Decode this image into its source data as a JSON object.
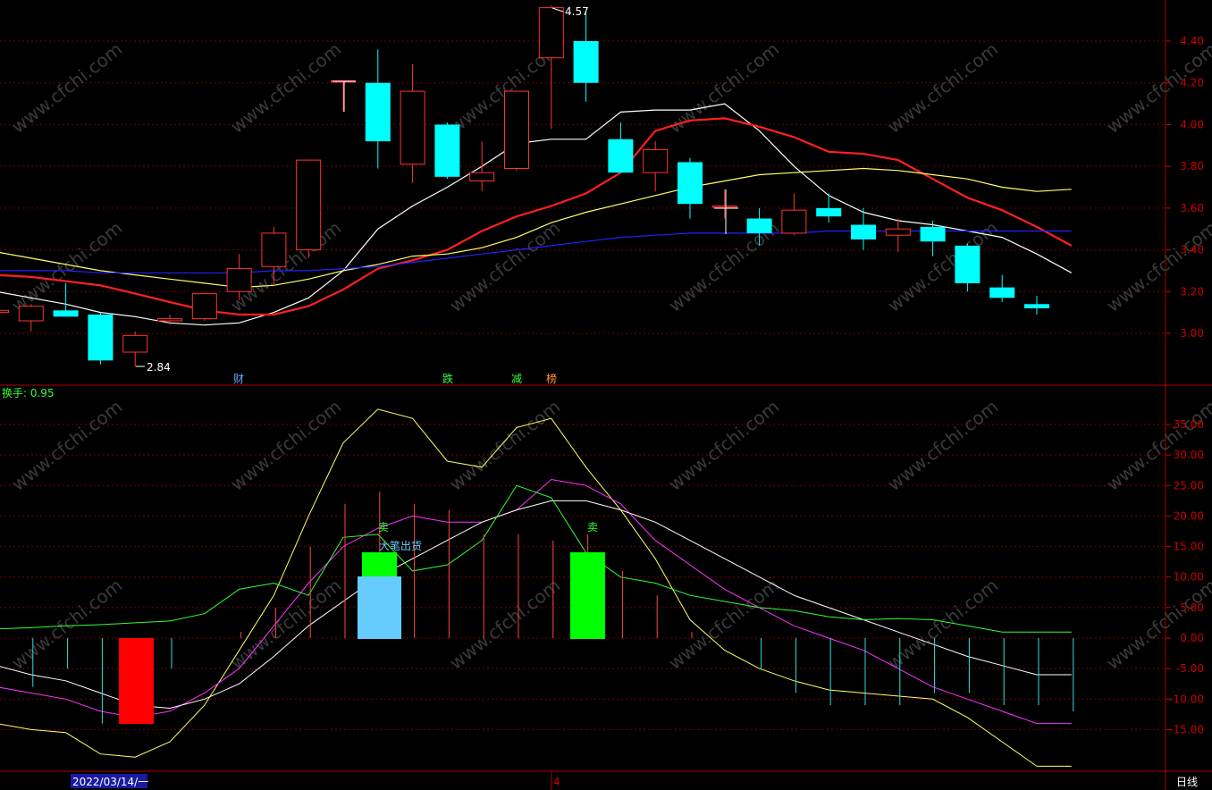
{
  "watermark": "www.cfchi.com",
  "price_panel": {
    "y_ticks": [
      "4.40",
      "4.20",
      "4.00",
      "3.80",
      "3.60",
      "3.40",
      "3.20",
      "3.00"
    ],
    "high_label": "4.57",
    "low_label": "2.84",
    "event_markers": [
      {
        "text": "财",
        "color": "#66aaff"
      },
      {
        "text": "跌",
        "color": "#33ff33"
      },
      {
        "text": "减",
        "color": "#33ff33"
      },
      {
        "text": "榜",
        "color": "#ff9933"
      }
    ]
  },
  "indicator_panel": {
    "turnover_label": "换手: 0.95",
    "y_ticks": [
      "35.00",
      "30.00",
      "25.00",
      "20.00",
      "15.00",
      "10.00",
      "5.00",
      "0.00",
      "-5.00",
      "-10.00",
      "-15.00"
    ],
    "signal_sell_1": "卖",
    "signal_big_sell": "大笔出货",
    "signal_sell_2": "卖"
  },
  "footer": {
    "date": "2022/03/14/一",
    "month_marker": "4",
    "period": "日线"
  },
  "colors": {
    "grid": "#7a0000",
    "axis_text": "#cc0000",
    "up": "#ff3333",
    "down": "#00ffff",
    "ma5": "#ffffff",
    "ma10": "#ff2020",
    "ma20": "#ffff66",
    "ma60": "#2222ff"
  },
  "chart_data": {
    "type": "candlestick",
    "y_range_price": [
      2.8,
      4.55
    ],
    "candles": [
      {
        "o": 3.1,
        "h": 3.12,
        "l": 3.09,
        "c": 3.11
      },
      {
        "o": 3.06,
        "h": 3.14,
        "l": 3.01,
        "c": 3.13
      },
      {
        "o": 3.11,
        "h": 3.24,
        "l": 3.09,
        "c": 3.08
      },
      {
        "o": 3.09,
        "h": 3.1,
        "l": 2.85,
        "c": 2.87
      },
      {
        "o": 2.91,
        "h": 3.01,
        "l": 2.84,
        "c": 2.99
      },
      {
        "o": 3.06,
        "h": 3.09,
        "l": 3.04,
        "c": 3.07
      },
      {
        "o": 3.07,
        "h": 3.19,
        "l": 3.06,
        "c": 3.19
      },
      {
        "o": 3.2,
        "h": 3.38,
        "l": 3.16,
        "c": 3.31
      },
      {
        "o": 3.32,
        "h": 3.51,
        "l": 3.23,
        "c": 3.48
      },
      {
        "o": 3.4,
        "h": 3.83,
        "l": 3.36,
        "c": 3.83
      },
      {
        "o": 4.21,
        "h": 4.21,
        "l": 4.06,
        "c": 4.21
      },
      {
        "o": 4.2,
        "h": 4.36,
        "l": 3.79,
        "c": 3.92
      },
      {
        "o": 3.81,
        "h": 4.29,
        "l": 3.72,
        "c": 4.16
      },
      {
        "o": 4.0,
        "h": 4.01,
        "l": 3.74,
        "c": 3.75
      },
      {
        "o": 3.73,
        "h": 3.92,
        "l": 3.68,
        "c": 3.77
      },
      {
        "o": 3.79,
        "h": 4.16,
        "l": 3.78,
        "c": 4.16
      },
      {
        "o": 4.32,
        "h": 4.57,
        "l": 3.98,
        "c": 4.56
      },
      {
        "o": 4.4,
        "h": 4.54,
        "l": 4.11,
        "c": 4.2
      },
      {
        "o": 3.93,
        "h": 4.01,
        "l": 3.77,
        "c": 3.77
      },
      {
        "o": 3.77,
        "h": 3.92,
        "l": 3.68,
        "c": 3.88
      },
      {
        "o": 3.82,
        "h": 3.84,
        "l": 3.55,
        "c": 3.62
      },
      {
        "o": 3.61,
        "h": 3.69,
        "l": 3.55,
        "c": 3.61
      },
      {
        "o": 3.55,
        "h": 3.6,
        "l": 3.42,
        "c": 3.48
      },
      {
        "o": 3.48,
        "h": 3.67,
        "l": 3.47,
        "c": 3.59
      },
      {
        "o": 3.6,
        "h": 3.67,
        "l": 3.53,
        "c": 3.56
      },
      {
        "o": 3.52,
        "h": 3.6,
        "l": 3.4,
        "c": 3.45
      },
      {
        "o": 3.47,
        "h": 3.55,
        "l": 3.39,
        "c": 3.5
      },
      {
        "o": 3.51,
        "h": 3.54,
        "l": 3.37,
        "c": 3.44
      },
      {
        "o": 3.42,
        "h": 3.43,
        "l": 3.2,
        "c": 3.24
      },
      {
        "o": 3.22,
        "h": 3.28,
        "l": 3.15,
        "c": 3.17
      },
      {
        "o": 3.14,
        "h": 3.18,
        "l": 3.09,
        "c": 3.12
      }
    ],
    "ma_lines": [
      {
        "key": "ma5",
        "values": [
          3.2,
          3.17,
          3.14,
          3.1,
          3.08,
          3.05,
          3.04,
          3.05,
          3.1,
          3.17,
          3.3,
          3.5,
          3.61,
          3.7,
          3.8,
          3.91,
          3.93,
          3.93,
          4.06,
          4.07,
          4.07,
          4.1,
          3.97,
          3.8,
          3.66,
          3.58,
          3.54,
          3.52,
          3.49,
          3.46,
          3.38,
          3.29
        ]
      },
      {
        "key": "ma10",
        "values": [
          3.28,
          3.27,
          3.25,
          3.23,
          3.19,
          3.15,
          3.11,
          3.09,
          3.09,
          3.13,
          3.21,
          3.31,
          3.35,
          3.4,
          3.49,
          3.56,
          3.61,
          3.67,
          3.77,
          3.97,
          4.02,
          4.03,
          3.99,
          3.94,
          3.87,
          3.86,
          3.83,
          3.74,
          3.65,
          3.59,
          3.51,
          3.42
        ]
      },
      {
        "key": "ma20",
        "values": [
          3.39,
          3.36,
          3.33,
          3.3,
          3.28,
          3.26,
          3.24,
          3.22,
          3.23,
          3.26,
          3.3,
          3.33,
          3.37,
          3.38,
          3.41,
          3.46,
          3.53,
          3.58,
          3.62,
          3.66,
          3.7,
          3.73,
          3.76,
          3.77,
          3.78,
          3.79,
          3.78,
          3.76,
          3.74,
          3.7,
          3.68,
          3.69
        ]
      },
      {
        "key": "ma60",
        "values": [
          3.3,
          3.3,
          3.3,
          3.29,
          3.29,
          3.29,
          3.29,
          3.29,
          3.3,
          3.3,
          3.31,
          3.32,
          3.34,
          3.36,
          3.38,
          3.4,
          3.42,
          3.44,
          3.46,
          3.47,
          3.48,
          3.48,
          3.48,
          3.48,
          3.49,
          3.49,
          3.49,
          3.49,
          3.49,
          3.49,
          3.49,
          3.49
        ]
      }
    ],
    "y_range_indicator": [
      -21,
      40
    ],
    "histogram": [
      -8,
      -8,
      -5,
      -14,
      -9,
      -5,
      0,
      1,
      5,
      15,
      22,
      24,
      22,
      21,
      17,
      17,
      16,
      17,
      11,
      7,
      1,
      0,
      -5,
      -9,
      -11,
      -11,
      -11,
      -9,
      -9,
      -11,
      -11,
      -12
    ],
    "indicator_lines": [
      {
        "key": "line_yellow",
        "color": "#ffff66",
        "values": [
          -14,
          -15,
          -15.5,
          -19,
          -19.5,
          -17,
          -11,
          -2,
          7,
          20,
          32,
          37.5,
          36,
          29,
          28,
          34.5,
          36,
          28,
          21,
          13,
          3,
          -2,
          -5,
          -7,
          -8.5,
          -9,
          -9.5,
          -10,
          -13,
          -17,
          -21,
          -21
        ]
      },
      {
        "key": "line_magenta",
        "color": "#ff33ff",
        "values": [
          -8,
          -9,
          -10,
          -12,
          -13,
          -12,
          -9,
          -5,
          2,
          9,
          15,
          18,
          20,
          19,
          19,
          21,
          26,
          25,
          22,
          16,
          12,
          8,
          5,
          2,
          0,
          -2,
          -5,
          -8,
          -10,
          -12,
          -14,
          -14
        ]
      },
      {
        "key": "line_white",
        "color": "#ffffff",
        "values": [
          -4.5,
          -6,
          -7,
          -9,
          -11,
          -11.5,
          -10,
          -7.5,
          -3,
          2,
          6,
          10,
          13,
          16,
          19,
          21,
          22.5,
          22.5,
          21,
          19,
          16,
          13,
          10,
          7,
          5,
          3,
          1,
          -1,
          -3,
          -4.5,
          -6,
          -6
        ]
      },
      {
        "key": "line_green",
        "color": "#33ff33",
        "values": [
          1.5,
          1.7,
          2,
          2.2,
          2.5,
          2.8,
          4,
          8,
          9,
          7,
          16.5,
          17,
          11,
          12,
          16,
          25,
          23,
          14,
          10,
          9,
          7,
          6,
          5,
          4.5,
          3.5,
          3,
          3.2,
          3,
          2,
          1,
          1,
          1
        ]
      }
    ]
  }
}
